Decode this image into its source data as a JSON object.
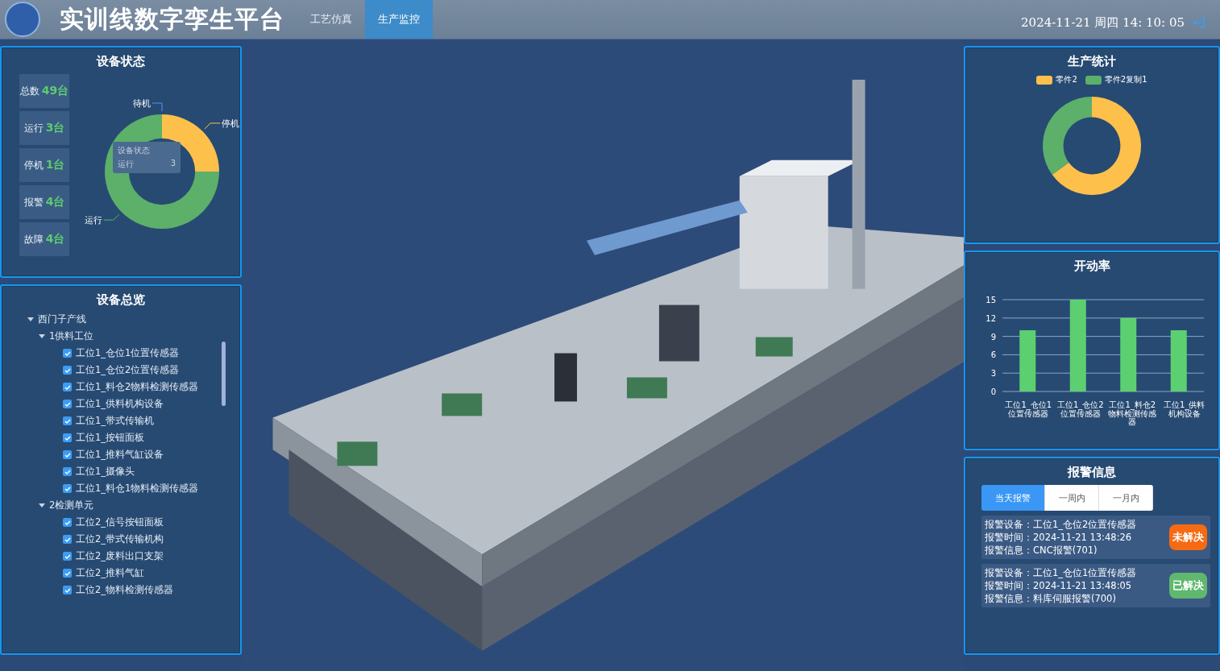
{
  "header": {
    "title": "实训线数字孪生平台",
    "tabs": [
      {
        "label": "工艺仿真",
        "selected": false
      },
      {
        "label": "生产监控",
        "selected": true
      }
    ],
    "datetime": "2024-11-21 周四 14: 10: 05"
  },
  "device_status": {
    "title": "设备状态",
    "stats": [
      {
        "label": "总数",
        "value": "49台"
      },
      {
        "label": "运行",
        "value": "3台"
      },
      {
        "label": "停机",
        "value": "1台"
      },
      {
        "label": "报警",
        "value": "4台"
      },
      {
        "label": "故障",
        "value": "4台"
      }
    ],
    "chart_data": {
      "type": "donut",
      "categories": [
        "待机",
        "停机",
        "运行"
      ],
      "values": [
        0,
        25,
        75
      ]
    },
    "slice_labels": true,
    "tooltip": {
      "title": "设备状态",
      "label": "运行",
      "value": "3"
    }
  },
  "device_overview": {
    "title": "设备总览",
    "tree": [
      {
        "label": "西门子产线",
        "expanded": true,
        "children": [
          {
            "label": "1供料工位",
            "expanded": true,
            "children": [
              {
                "label": "工位1_仓位1位置传感器",
                "checked": true
              },
              {
                "label": "工位1_仓位2位置传感器",
                "checked": true
              },
              {
                "label": "工位1_料仓2物料检测传感器",
                "checked": true
              },
              {
                "label": "工位1_供料机构设备",
                "checked": true
              },
              {
                "label": "工位1_带式传输机",
                "checked": true
              },
              {
                "label": "工位1_按钮面板",
                "checked": true
              },
              {
                "label": "工位1_推料气缸设备",
                "checked": true
              },
              {
                "label": "工位1_摄像头",
                "checked": true
              },
              {
                "label": "工位1_料仓1物料检测传感器",
                "checked": true
              }
            ]
          },
          {
            "label": "2检测单元",
            "expanded": true,
            "children": [
              {
                "label": "工位2_信号按钮面板",
                "checked": true
              },
              {
                "label": "工位2_带式传输机构",
                "checked": true
              },
              {
                "label": "工位2_废料出口支架",
                "checked": true
              },
              {
                "label": "工位2_推料气缸",
                "checked": true
              },
              {
                "label": "工位2_物料检测传感器",
                "checked": true
              }
            ]
          }
        ]
      }
    ]
  },
  "production_stats": {
    "title": "生产统计",
    "chart_data": {
      "type": "donut",
      "categories": [
        "零件2",
        "零件2复制1"
      ],
      "values": [
        65,
        35
      ],
      "legend": "top"
    }
  },
  "utilization": {
    "title": "开动率",
    "chart_data": {
      "type": "bar",
      "categories": [
        "工位1_仓位1位置传感器",
        "工位1_仓位2位置传感器",
        "工位1_料仓2物料检测传感器",
        "工位1_供料机构设备"
      ],
      "values": [
        10,
        15,
        12,
        10
      ],
      "ylim": [
        0,
        15
      ],
      "yticks": [
        0,
        3,
        6,
        9,
        12,
        15
      ],
      "grid": true
    }
  },
  "alarms": {
    "title": "报警信息",
    "tabs": [
      {
        "label": "当天报警",
        "selected": true
      },
      {
        "label": "一周内",
        "selected": false
      },
      {
        "label": "一月内",
        "selected": false
      }
    ],
    "items": [
      {
        "lines": [
          "报警设备：工位1_仓位2位置传感器",
          "报警时间：2024-11-21 13:48:26",
          "报警信息：CNC报警(701)"
        ],
        "status": "未解决",
        "kind": "unresolved"
      },
      {
        "lines": [
          "报警设备：工位1_仓位1位置传感器",
          "报警时间：2024-11-21 13:48:05",
          "报警信息：料库伺服报警(700)"
        ],
        "status": "已解决",
        "kind": "resolved"
      }
    ]
  }
}
